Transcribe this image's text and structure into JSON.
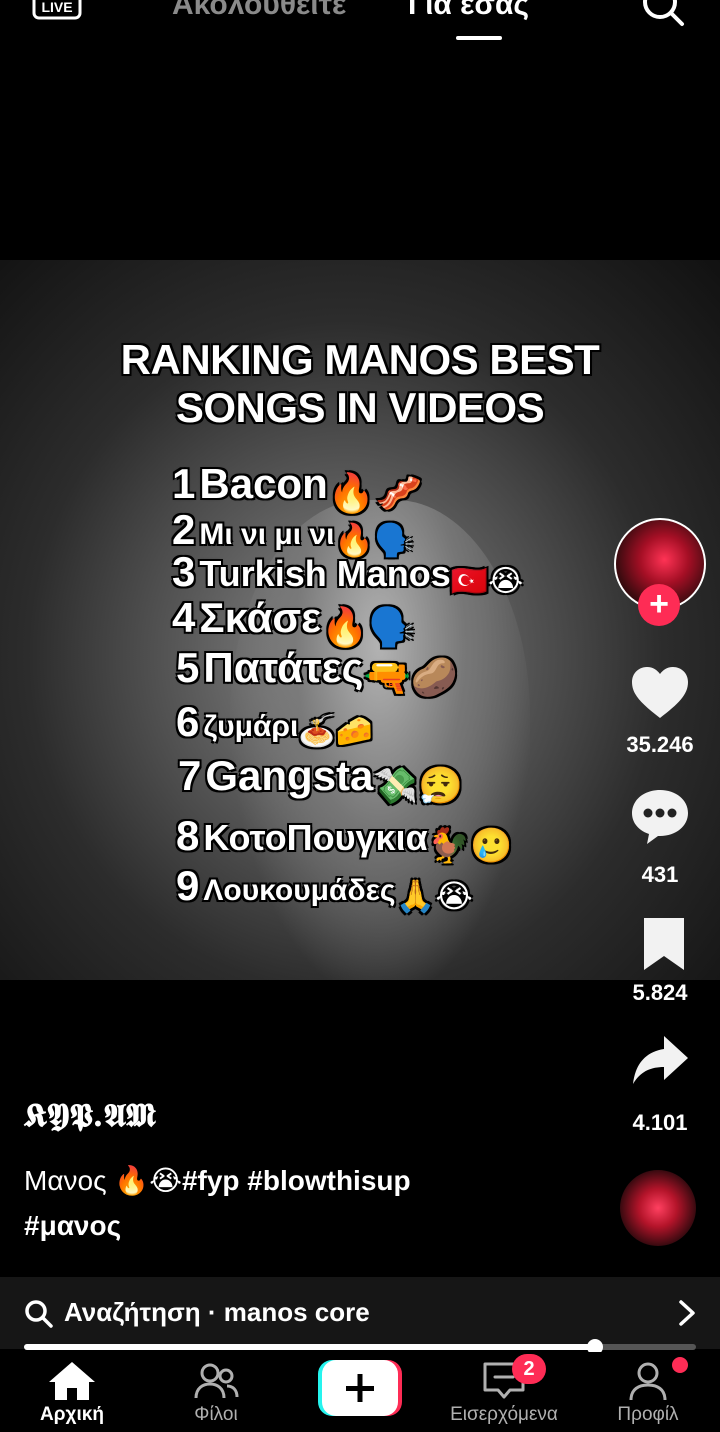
{
  "top_bar": {
    "live_label": "LIVE",
    "tab_following": "Ακολουθείτε",
    "tab_for_you": "Για εσάς"
  },
  "video": {
    "title_line1": "RANKING MANOS BEST",
    "title_line2": "SONGS IN VIDEOS",
    "ranking": [
      {
        "num": "1",
        "name": "Bacon",
        "emoji": "🔥🥓"
      },
      {
        "num": "2",
        "name": "Μι νι μι νι",
        "emoji": "🔥🗣️"
      },
      {
        "num": "3",
        "name": "Turkish Manos",
        "emoji": "🇹🇷😭"
      },
      {
        "num": "4",
        "name": "Σκάσε",
        "emoji": "🔥🗣️"
      },
      {
        "num": "5",
        "name": "Πατάτες",
        "emoji": "🔫🥔"
      },
      {
        "num": "6",
        "name": "ζυμάρι",
        "emoji": "🍝🧀"
      },
      {
        "num": "7",
        "name": "Gangsta",
        "emoji": "💸😮‍💨"
      },
      {
        "num": "8",
        "name": "ΚοτοΠουγκια",
        "emoji": "🐓🥲"
      },
      {
        "num": "9",
        "name": "Λουκουμάδες",
        "emoji": "🙏😭"
      }
    ]
  },
  "actions": {
    "likes": "35.246",
    "comments": "431",
    "saves": "5.824",
    "shares": "4.101"
  },
  "post": {
    "username": "𝕶𝖄𝕻.𝕬𝕸",
    "caption_text": "Μανος 🔥😭",
    "caption_tags_1": "#fyp #blowthisup",
    "caption_tags_2": "#μανος"
  },
  "search_suggestion": {
    "label": "Αναζήτηση · manos core"
  },
  "progress": 0.85,
  "bottom_nav": {
    "home": "Αρχική",
    "friends": "Φίλοι",
    "inbox": "Εισερχόμενα",
    "inbox_badge": "2",
    "profile": "Προφίλ"
  },
  "colors": {
    "accent": "#fe2c55",
    "background": "#000000",
    "create_cyan": "#25f4ee"
  }
}
